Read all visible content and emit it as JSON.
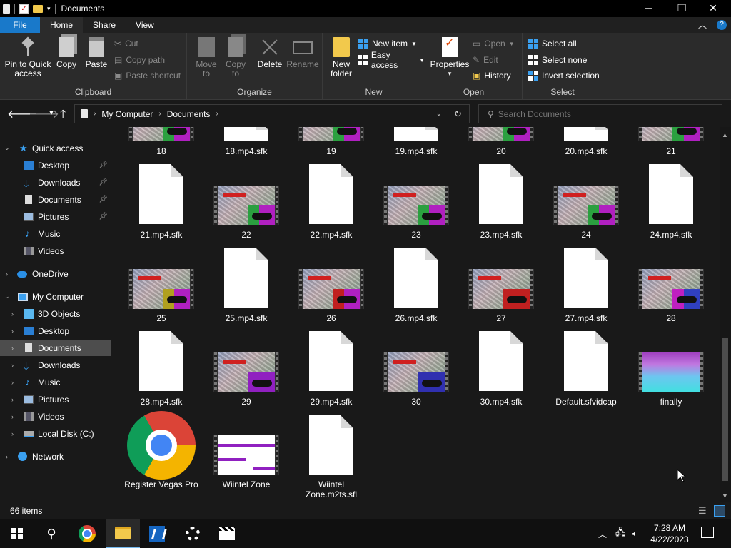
{
  "window": {
    "title": "Documents"
  },
  "ribbon_tabs": [
    "File",
    "Home",
    "Share",
    "View"
  ],
  "ribbon": {
    "clipboard": {
      "label": "Clipboard",
      "pin": "Pin to Quick access",
      "copy": "Copy",
      "paste": "Paste",
      "cut": "Cut",
      "copy_path": "Copy path",
      "paste_shortcut": "Paste shortcut"
    },
    "organize": {
      "label": "Organize",
      "move_to": "Move to",
      "copy_to": "Copy to",
      "delete": "Delete",
      "rename": "Rename"
    },
    "new": {
      "label": "New",
      "new_folder": "New folder",
      "new_item": "New item",
      "easy_access": "Easy access"
    },
    "open": {
      "label": "Open",
      "properties": "Properties",
      "open": "Open",
      "edit": "Edit",
      "history": "History"
    },
    "select": {
      "label": "Select",
      "select_all": "Select all",
      "select_none": "Select none",
      "invert": "Invert selection"
    }
  },
  "address": {
    "crumbs": [
      "My Computer",
      "Documents"
    ],
    "search_placeholder": "Search Documents"
  },
  "nav": {
    "quick_access": "Quick access",
    "qa_items": [
      "Desktop",
      "Downloads",
      "Documents",
      "Pictures",
      "Music",
      "Videos"
    ],
    "onedrive": "OneDrive",
    "my_computer": "My Computer",
    "pc_items": [
      "3D Objects",
      "Desktop",
      "Documents",
      "Downloads",
      "Music",
      "Pictures",
      "Videos",
      "Local Disk (C:)"
    ],
    "network": "Network"
  },
  "files": {
    "row0": [
      "18",
      "18.mp4.sfk",
      "19",
      "19.mp4.sfk",
      "20",
      "20.mp4.sfk",
      "21"
    ],
    "row1": [
      "21.mp4.sfk",
      "22",
      "22.mp4.sfk",
      "23",
      "23.mp4.sfk",
      "24",
      "24.mp4.sfk"
    ],
    "row2": [
      "25",
      "25.mp4.sfk",
      "26",
      "26.mp4.sfk",
      "27",
      "27.mp4.sfk",
      "28"
    ],
    "row3": [
      "28.mp4.sfk",
      "29",
      "29.mp4.sfk",
      "30",
      "30.mp4.sfk",
      "Default.sfvidcap",
      "finally"
    ],
    "row4": [
      "Register Vegas Pro",
      "Wiintel Zone",
      "Wiintel Zone.m2ts.sfl"
    ]
  },
  "status": {
    "item_count": "66 items"
  },
  "taskbar": {
    "time": "7:28 AM",
    "date": "4/22/2023"
  }
}
